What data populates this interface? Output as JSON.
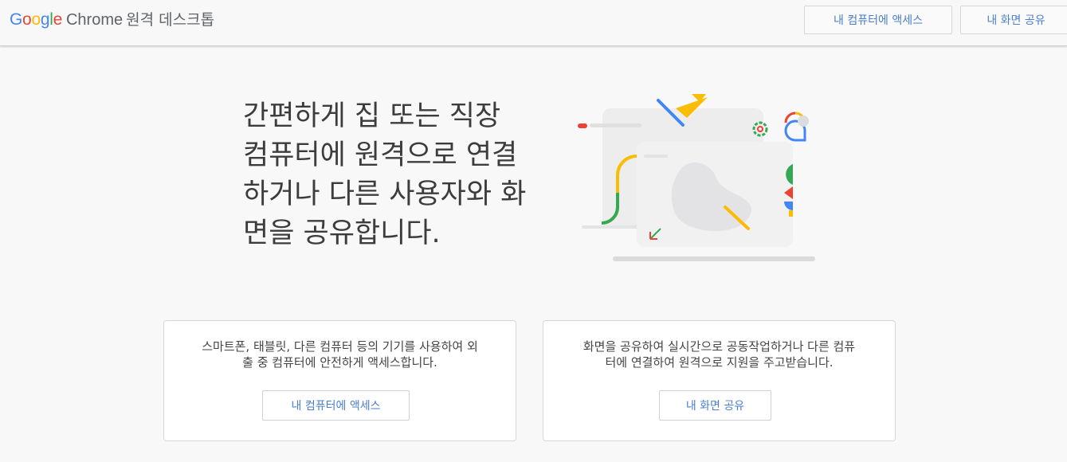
{
  "header": {
    "logo_google": "Google",
    "logo_chrome": "Chrome",
    "logo_product": "원격 데스크톱",
    "access_button": "내 컴퓨터에 액세스",
    "share_button": "내 화면 공유"
  },
  "hero": {
    "headline_line1": "간편하게 집 또는 직장",
    "headline_line2": "컴퓨터에 원격으로 연결",
    "headline_line3": "하거나 다른 사용자와 화",
    "headline_line4": "면을 공유합니다."
  },
  "cards": {
    "access": {
      "description_line1": "스마트폰, 태블릿, 다른 컴퓨터 등의 기기를 사용하여 외",
      "description_line2": "출 중 컴퓨터에 안전하게 액세스합니다.",
      "button": "내 컴퓨터에 액세스"
    },
    "share": {
      "description_line1": "화면을 공유하여 실시간으로 공동작업하거나 다른 컴퓨",
      "description_line2": "터에 연결하여 원격으로 지원을 주고받습니다.",
      "button": "내 화면 공유"
    }
  },
  "colors": {
    "google_blue": "#4285f4",
    "google_red": "#ea4335",
    "google_yellow": "#fbbc05",
    "google_green": "#34a853",
    "link_blue": "#4a7fcf"
  }
}
